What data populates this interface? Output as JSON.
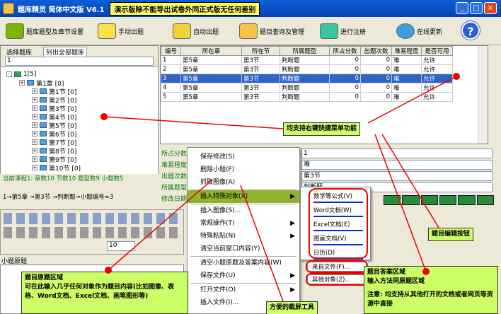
{
  "window": {
    "title": "题库精灵  简体中文版  V6.1",
    "banner": "演示版除不能导出试卷外同正式版无任何差别",
    "minimize": "_",
    "maximize": "□",
    "close": "×"
  },
  "toolbar": {
    "items": [
      {
        "label": "题库题型及章节设置",
        "color": "#7ab800"
      },
      {
        "label": "手动出题",
        "color": "#f7e24a"
      },
      {
        "label": "自动出题",
        "color": "#f2d03a"
      },
      {
        "label": "题目查询及管理",
        "color": "#f5c24a"
      },
      {
        "label": "进行注册",
        "color": "#39c4a0"
      },
      {
        "label": "在线更新",
        "color": "#3aa0e0"
      }
    ],
    "help": "?"
  },
  "left": {
    "tab_select": "选择题库",
    "tab_list_all": "列出全部题库",
    "dropdown_value": "1",
    "tree": [
      {
        "label": "1[5]",
        "indent": 0
      },
      {
        "label": "第1章 [0]",
        "indent": 1
      },
      {
        "label": "第1节 [0]",
        "indent": 2
      },
      {
        "label": "第2节 [0]",
        "indent": 2
      },
      {
        "label": "第3节 [0]",
        "indent": 2
      },
      {
        "label": "第4节 [0]",
        "indent": 2
      },
      {
        "label": "第5节 [0]",
        "indent": 2
      },
      {
        "label": "第6节 [0]",
        "indent": 2
      },
      {
        "label": "第7节 [0]",
        "indent": 2
      },
      {
        "label": "第8节 [0]",
        "indent": 2
      },
      {
        "label": "第9节 [0]",
        "indent": 2
      },
      {
        "label": "第10节 [0]",
        "indent": 2
      }
    ],
    "status1": "当前课程1: 章数10  节数10  题型数9  小题数5",
    "status2": "1→第5章  →第3节  →判断题→小题编号=3"
  },
  "grid": {
    "headers": [
      "编号",
      "所在章",
      "所在节",
      "所属题型",
      "所占分数",
      "出题次数",
      "难易程度",
      "是否可用"
    ],
    "rows": [
      {
        "id": "1",
        "chapter": "第5章",
        "section": "第3节",
        "type": "判断题",
        "score": "0",
        "count": "0",
        "level": "难",
        "usable": "允许"
      },
      {
        "id": "2",
        "chapter": "第5章",
        "section": "第3节",
        "type": "判断题",
        "score": "0",
        "count": "0",
        "level": "难",
        "usable": "允许"
      },
      {
        "id": "3",
        "chapter": "第5章",
        "section": "第3节",
        "type": "判断题",
        "score": "0",
        "count": "0",
        "level": "难",
        "usable": "允许"
      },
      {
        "id": "4",
        "chapter": "第5章",
        "section": "第3节",
        "type": "判断题",
        "score": "0",
        "count": "0",
        "level": "难",
        "usable": "允许"
      },
      {
        "id": "5",
        "chapter": "第5章",
        "section": "第3节",
        "type": "判断题",
        "score": "0",
        "count": "0",
        "level": "难",
        "usable": "允许"
      }
    ],
    "selected_index": 2
  },
  "form": {
    "labels": [
      "所占分数",
      "难易程度",
      "出题次数",
      "所属题型",
      "修改日期"
    ],
    "values": [
      "1",
      "难",
      "第3节",
      "判断题",
      ""
    ]
  },
  "editor": {
    "font_size": "10",
    "question_label": "小题原题"
  },
  "context_menu": {
    "items": [
      {
        "label": "保存修改(S)",
        "sub": false
      },
      {
        "label": "删除小题(F)",
        "sub": false
      },
      {
        "label": "抓取图像(A)",
        "sub": false
      },
      {
        "label": "插入特殊对象(X)",
        "sub": true,
        "hl": true
      },
      {
        "label": "插入图像(S)...",
        "sub": false
      },
      {
        "label": "常规操作(T)",
        "sub": true
      },
      {
        "label": "特殊粘贴(N)",
        "sub": true
      },
      {
        "label": "清空当前窗口内容(Y)",
        "sub": false
      },
      {
        "label": "清空小题原题及答案内容(W)",
        "sub": false
      },
      {
        "label": "保存文件(U)",
        "sub": true
      },
      {
        "label": "打开文件(O)",
        "sub": true
      },
      {
        "label": "插入文件(I)...",
        "sub": false
      }
    ]
  },
  "submenu": {
    "items": [
      "数学等公式(V)",
      "Word文档(W)",
      "Excel文档(E)",
      "图画文档(V)",
      "日历(D)"
    ],
    "from_file": "来自文件(F)...",
    "other": "其他对象(Z)..."
  },
  "annotations": {
    "right_click": "均支持右键快捷菜单功能",
    "edit_buttons": "题目编辑按钮",
    "question_area_title": "题目原题区域",
    "question_area_body": "可在此输入几乎任何对象作为题目内容(比如图像、表格、Word文档、Excel文档、画笔图形等)",
    "answer_area_title": "题目答案区域",
    "answer_area_body": "输入方法同原题区域",
    "answer_note": "注意: 均支持从其他打开的文档或者网页等资源中直接",
    "screenshot_tool": "方便的截屏工具"
  }
}
